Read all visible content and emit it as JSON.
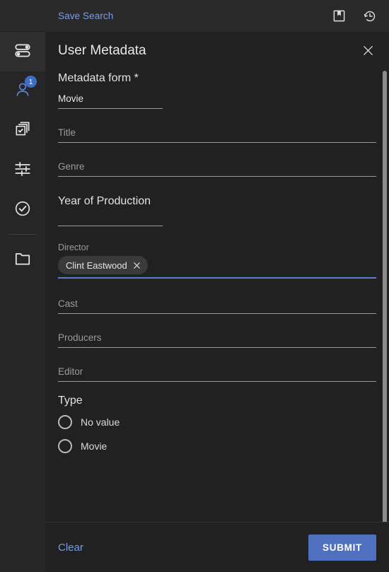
{
  "topbar": {
    "save_search_label": "Save Search",
    "icons": [
      {
        "name": "bookmark-icon"
      },
      {
        "name": "history-icon"
      }
    ]
  },
  "sidebar": {
    "items": [
      {
        "name": "toggles-icon",
        "selected": true,
        "badge": null
      },
      {
        "name": "user-icon",
        "selected": false,
        "badge": "1",
        "active": true
      },
      {
        "name": "stacked-cards-check-icon",
        "selected": false,
        "badge": null
      },
      {
        "name": "tune-sliders-icon",
        "selected": false,
        "badge": null
      },
      {
        "name": "check-circle-icon",
        "selected": false,
        "badge": null
      },
      {
        "name": "folder-icon",
        "selected": false,
        "badge": null
      }
    ]
  },
  "dialog": {
    "title": "User Metadata",
    "close_icon": "close-icon",
    "form_section_label": "Metadata form *",
    "fields": [
      {
        "label": "",
        "value": "Movie",
        "placeholder": ""
      },
      {
        "label": "",
        "value": "",
        "placeholder": "Title"
      },
      {
        "label": "",
        "value": "",
        "placeholder": "Genre"
      },
      {
        "label": "Year of Production",
        "value": "",
        "placeholder": ""
      },
      {
        "label": "Director",
        "value": "",
        "placeholder": "",
        "chips": [
          "Clint Eastwood"
        ]
      },
      {
        "label": "",
        "value": "",
        "placeholder": "Cast"
      },
      {
        "label": "",
        "value": "",
        "placeholder": "Producers"
      },
      {
        "label": "",
        "value": "",
        "placeholder": "Editor"
      }
    ],
    "type_group": {
      "label": "Type",
      "options": [
        "No value",
        "Movie"
      ],
      "selected": null
    }
  },
  "footer": {
    "clear_label": "Clear",
    "submit_label": "SUBMIT"
  },
  "colors": {
    "accent_blue": "#4f6fbf",
    "link_blue": "#7d9ae0",
    "badge_blue": "#3d6ec7",
    "dialog_bg": "#212121",
    "rail_bg": "#262626",
    "topbar_bg": "#2a2a2a"
  }
}
